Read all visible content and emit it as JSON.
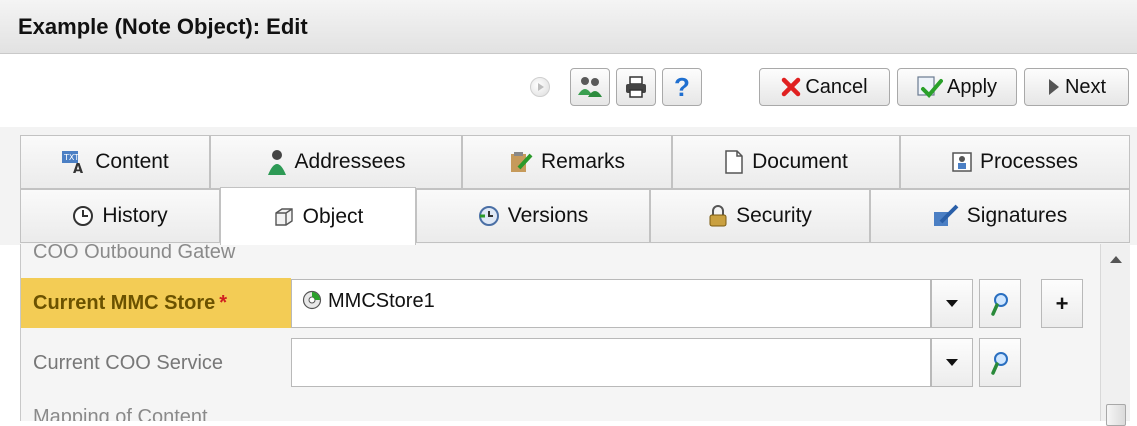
{
  "window": {
    "title": "Example (Note Object): Edit"
  },
  "toolbar": {
    "cancel_label": "Cancel",
    "apply_label": "Apply",
    "next_label": "Next",
    "help_label": "?"
  },
  "tabs": {
    "row1": [
      "Content",
      "Addressees",
      "Remarks",
      "Document",
      "Processes"
    ],
    "row2": [
      "History",
      "Object",
      "Versions",
      "Security",
      "Signatures"
    ],
    "active": "Object"
  },
  "form": {
    "partial_top_label": "COO Outbound Gatew",
    "mmc_store_label": "Current MMC Store",
    "mmc_store_value": "MMCStore1",
    "required_marker": "*",
    "coo_service_label": "Current COO Service",
    "coo_service_value": "",
    "add_symbol": "+",
    "partial_bottom_label": "Mapping of Content Changes"
  },
  "colors": {
    "required_highlight": "#f3cc55",
    "required_star": "#d02020",
    "cancel_icon": "#e02020",
    "help_icon": "#1f6fd0"
  }
}
